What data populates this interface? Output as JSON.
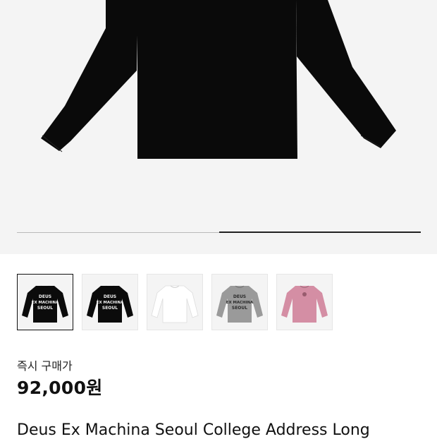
{
  "product": {
    "price_label": "즉시 구매가",
    "price": "92,000원",
    "title": "Deus Ex Machina Seoul College Address Long"
  },
  "gallery": {
    "progress": 0.5,
    "thumbnails": [
      {
        "color": "black",
        "print": [
          "DEUS",
          "EX MACHINA",
          "SEOUL"
        ],
        "selected": true
      },
      {
        "color": "black",
        "print": [
          "DEUS",
          "EX MACHINA",
          "SEOUL"
        ],
        "selected": false
      },
      {
        "color": "white",
        "print": [],
        "selected": false
      },
      {
        "color": "grey",
        "print": [
          "DEUS",
          "EX MACHINA",
          "SEOUL"
        ],
        "selected": false
      },
      {
        "color": "pink",
        "print": [],
        "selected": false
      }
    ]
  },
  "colors": {
    "black": "#0b0b0b",
    "white": "#ffffff",
    "grey": "#9a9a9a",
    "pink": "#d48ea4",
    "hero_bg": "#f4f4f4"
  }
}
